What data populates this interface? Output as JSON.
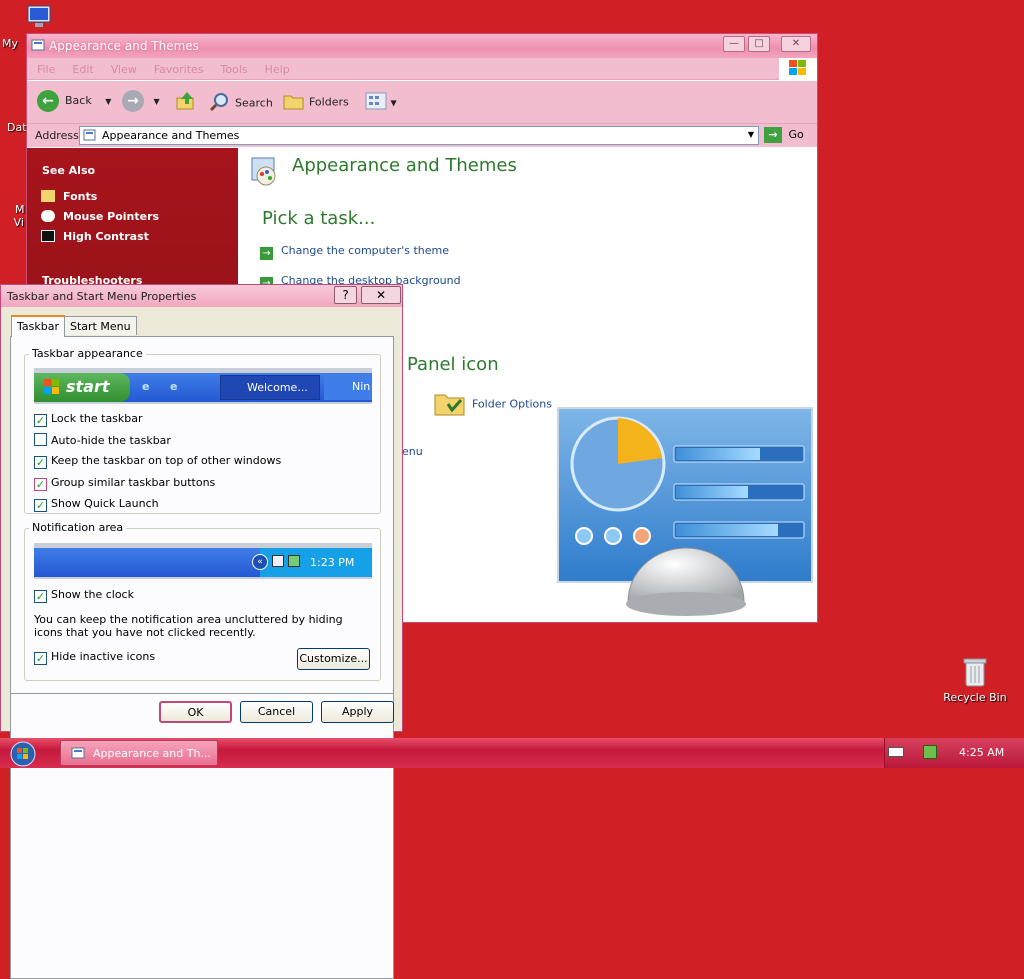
{
  "desktop": {
    "icons": [
      {
        "label": "My"
      },
      {
        "label": "Dat"
      },
      {
        "label": "M"
      },
      {
        "label": "Vi"
      }
    ],
    "recycle_bin": "Recycle Bin"
  },
  "explorer": {
    "title": "Appearance and Themes",
    "menu": [
      "File",
      "Edit",
      "View",
      "Favorites",
      "Tools",
      "Help"
    ],
    "toolbar": {
      "back": "Back",
      "search": "Search",
      "folders": "Folders"
    },
    "address": {
      "label": "Address",
      "value": "Appearance and Themes",
      "go": "Go"
    },
    "sidebar": {
      "see_also_title": "See Also",
      "see_also": [
        "Fonts",
        "Mouse Pointers",
        "High Contrast"
      ],
      "troubleshooters_title": "Troubleshooters"
    },
    "content": {
      "heading": "Appearance and Themes",
      "pick_task": "Pick a task...",
      "tasks": [
        "Change the computer's theme",
        "Change the desktop background"
      ],
      "panel_icon_text": "Panel icon",
      "folder_options": "Folder Options",
      "menu_fragment": "enu"
    }
  },
  "dialog": {
    "title": "Taskbar and Start Menu Properties",
    "help_btn": "?",
    "close_btn": "✕",
    "tabs": [
      "Taskbar",
      "Start Menu"
    ],
    "taskbar_appearance": {
      "legend": "Taskbar appearance",
      "start_label": "start",
      "preview_button": "Welcome...",
      "preview_button2": "Nin",
      "options": [
        {
          "label": "Lock the taskbar",
          "checked": true
        },
        {
          "label": "Auto-hide the taskbar",
          "checked": false
        },
        {
          "label": "Keep the taskbar on top of other windows",
          "checked": true
        },
        {
          "label": "Group similar taskbar buttons",
          "checked": true
        },
        {
          "label": "Show Quick Launch",
          "checked": true
        }
      ]
    },
    "notification_area": {
      "legend": "Notification area",
      "preview_time": "1:23 PM",
      "show_clock": "Show the clock",
      "description": "You can keep the notification area uncluttered by hiding icons that you have not clicked recently.",
      "hide_inactive": "Hide inactive icons",
      "customize": "Customize..."
    },
    "buttons": {
      "ok": "OK",
      "cancel": "Cancel",
      "apply": "Apply"
    }
  },
  "taskbar": {
    "task_button": "Appearance and Th...",
    "clock": "4:25 AM"
  },
  "colors": {
    "desktop_bg": "#d01f25",
    "window_pink": "#f3bdd0",
    "sidebar_red": "#a7141c",
    "link_blue": "#1e4a8c",
    "heading_green": "#2d7a2d"
  }
}
